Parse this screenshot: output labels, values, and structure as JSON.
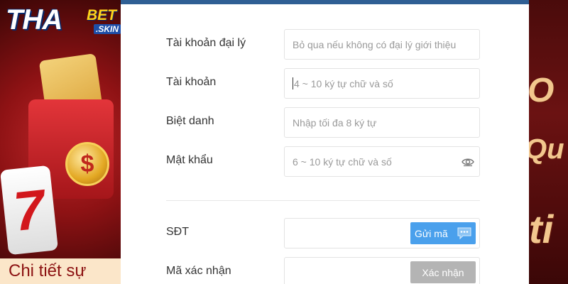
{
  "brand": {
    "logo_main": "THA",
    "logo_accent": "BET",
    "logo_suffix": ".SKIN"
  },
  "background": {
    "promo_text": "Chi tiết sự",
    "right_glyphs": [
      "O",
      "Qu",
      "ti"
    ],
    "coin_symbol": "$",
    "slot_symbol": "7"
  },
  "form": {
    "fields": [
      {
        "label": "Tài khoản đại lý",
        "placeholder": "Bỏ qua nếu không có đại lý giới thiệu"
      },
      {
        "label": "Tài khoản",
        "placeholder": "4 ~ 10 ký tự chữ và số"
      },
      {
        "label": "Biệt danh",
        "placeholder": "Nhập tối đa 8 ký tự"
      },
      {
        "label": "Mật khẩu",
        "placeholder": "6 ~ 10 ký tự chữ và số"
      },
      {
        "label": "SĐT",
        "placeholder": ""
      },
      {
        "label": "Mã xác nhận",
        "placeholder": ""
      }
    ],
    "send_code_label": "Gửi mã",
    "verify_label": "Xác nhận"
  },
  "icons": {
    "password_toggle": "eye-icon",
    "send_code": "chat-bubble-icon"
  },
  "colors": {
    "topbar": "#2f5f94",
    "send_button": "#4aa0ec",
    "verify_button": "#b4b4b4"
  }
}
